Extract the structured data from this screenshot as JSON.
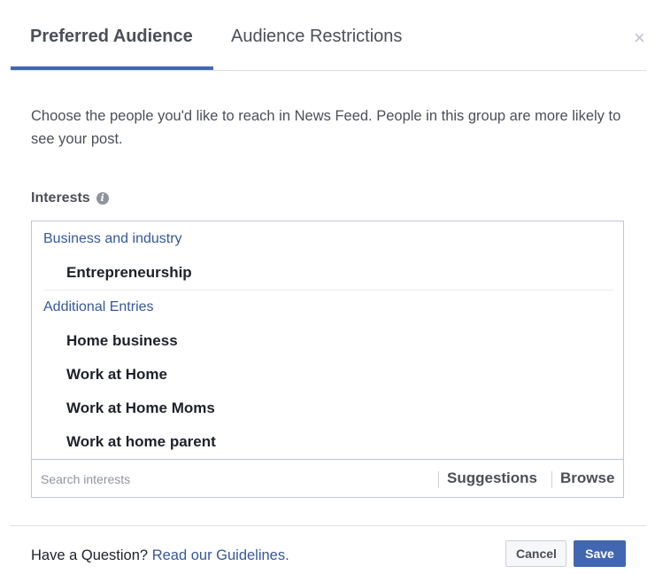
{
  "tabs": {
    "preferred": "Preferred Audience",
    "restrictions": "Audience Restrictions",
    "close_icon": "×"
  },
  "description": "Choose the people you'd like to reach in News Feed. People in this group are more likely to see your post.",
  "interests": {
    "label": "Interests",
    "info_icon": "i",
    "groups": [
      {
        "title": "Business and industry",
        "items": [
          "Entrepreneurship"
        ]
      },
      {
        "title": "Additional Entries",
        "items": [
          "Home business",
          "Work at Home",
          "Work at Home Moms",
          "Work at home parent"
        ]
      }
    ],
    "search_placeholder": "Search interests",
    "suggestions": "Suggestions",
    "browse": "Browse"
  },
  "footer": {
    "question": "Have a Question?",
    "guidelines_link": "Read our Guidelines.",
    "cancel": "Cancel",
    "save": "Save"
  },
  "colors": {
    "accent": "#4267b2",
    "link": "#365899"
  }
}
